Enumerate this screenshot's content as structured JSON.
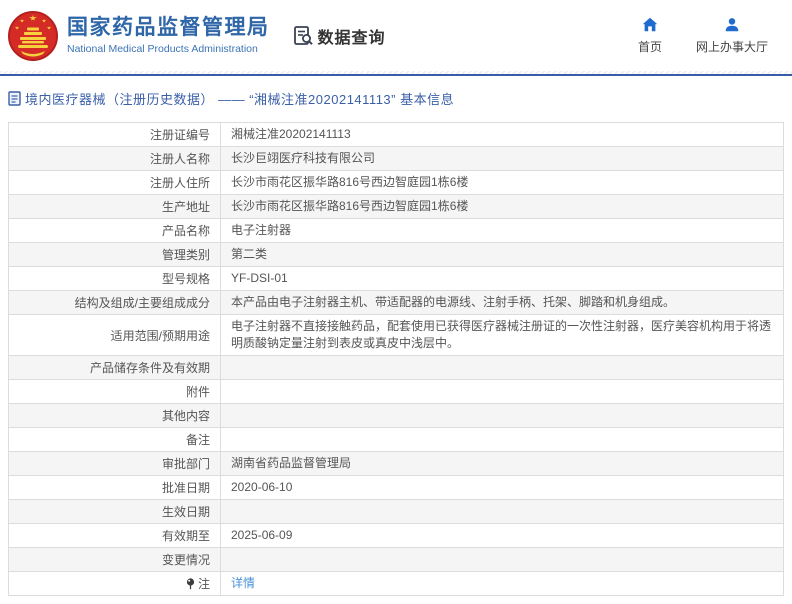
{
  "header": {
    "org_title_cn": "国家药品监督管理局",
    "org_title_en": "National Medical Products Administration",
    "dataquery_label": "数据查询",
    "nav": [
      {
        "label": "首页",
        "icon": "home-icon"
      },
      {
        "label": "网上办事大厅",
        "icon": "person-icon"
      }
    ]
  },
  "breadcrumb": {
    "text": "境内医疗器械（注册历史数据） —— “湘械注准20202141113” 基本信息"
  },
  "colors": {
    "brand_blue": "#2e66a8",
    "nav_icon_blue": "#1f6bd0",
    "divider_blue": "#3a5ba8",
    "link_blue": "#4a90d9",
    "row_alt_gray": "#f5f5f5",
    "border_gray": "#dcdcdc",
    "emblem_red": "#d42b27",
    "emblem_gold": "#f7d23e"
  },
  "table": {
    "rows": [
      {
        "label": "注册证编号",
        "value": "湘械注准20202141113"
      },
      {
        "label": "注册人名称",
        "value": "长沙巨翊医疗科技有限公司"
      },
      {
        "label": "注册人住所",
        "value": "长沙市雨花区振华路816号西边智庭园1栋6楼"
      },
      {
        "label": "生产地址",
        "value": "长沙市雨花区振华路816号西边智庭园1栋6楼"
      },
      {
        "label": "产品名称",
        "value": "电子注射器"
      },
      {
        "label": "管理类别",
        "value": "第二类"
      },
      {
        "label": "型号规格",
        "value": "YF-DSI-01"
      },
      {
        "label": "结构及组成/主要组成成分",
        "value": "本产品由电子注射器主机、带适配器的电源线、注射手柄、托架、脚踏和机身组成。"
      },
      {
        "label": "适用范围/预期用途",
        "value": "电子注射器不直接接触药品，配套使用已获得医疗器械注册证的一次性注射器，医疗美容机构用于将透明质酸钠定量注射到表皮或真皮中浅层中。"
      },
      {
        "label": "产品储存条件及有效期",
        "value": ""
      },
      {
        "label": "附件",
        "value": ""
      },
      {
        "label": "其他内容",
        "value": ""
      },
      {
        "label": "备注",
        "value": ""
      },
      {
        "label": "审批部门",
        "value": "湖南省药品监督管理局"
      },
      {
        "label": "批准日期",
        "value": "2020-06-10"
      },
      {
        "label": "生效日期",
        "value": ""
      },
      {
        "label": "有效期至",
        "value": "2025-06-09"
      },
      {
        "label": "变更情况",
        "value": ""
      },
      {
        "label": "注",
        "value": "详情",
        "has_note_icon": true,
        "value_is_link": true
      }
    ]
  }
}
